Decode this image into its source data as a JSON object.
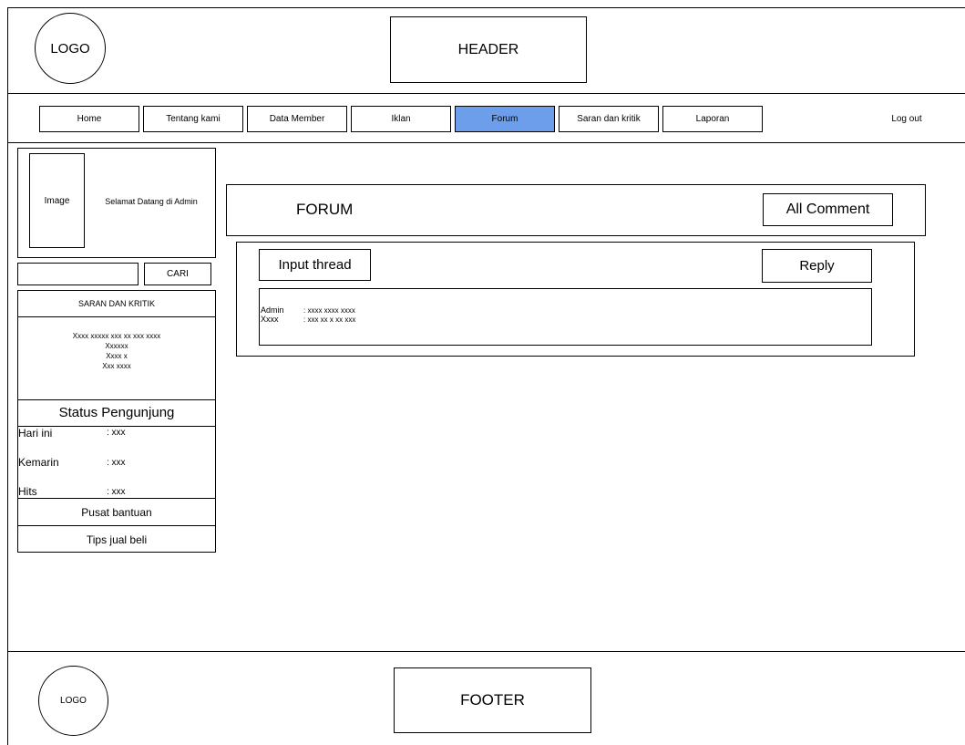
{
  "header": {
    "logo": "LOGO",
    "title": "HEADER"
  },
  "nav": {
    "items": [
      "Home",
      "Tentang kami",
      "Data Member",
      "Iklan",
      "Forum",
      "Saran dan kritik",
      "Laporan"
    ],
    "active": "Forum",
    "active_color": "#6d9eeb",
    "logout": "Log out"
  },
  "sidebar": {
    "image_label": "Image",
    "welcome": "Selamat Datang di Admin",
    "search": {
      "value": "",
      "button": "CARI"
    },
    "saran": {
      "title": "SARAN DAN KRITIK",
      "lines": [
        "Xxxx xxxxx xxx xx xxx xxxx",
        "Xxxxxx",
        "Xxxx x",
        "Xxx xxxx"
      ]
    },
    "status": {
      "title": "Status Pengunjung",
      "rows": [
        {
          "label": "Hari ini",
          "value": ": xxx"
        },
        {
          "label": "Kemarin",
          "value": ": xxx"
        },
        {
          "label": "Hits",
          "value": ": xxx"
        }
      ]
    },
    "links": [
      "Pusat bantuan",
      "Tips jual beli"
    ]
  },
  "forum": {
    "title": "FORUM",
    "all_comment": "All Comment",
    "input_thread": "Input thread",
    "reply": "Reply",
    "posts": [
      {
        "user": "Admin",
        "text": ": xxxx xxxx xxxx"
      },
      {
        "user": "Xxxx",
        "text": ": xxx xx x xx xxx"
      }
    ]
  },
  "footer": {
    "logo": "LOGO",
    "title": "FOOTER"
  }
}
